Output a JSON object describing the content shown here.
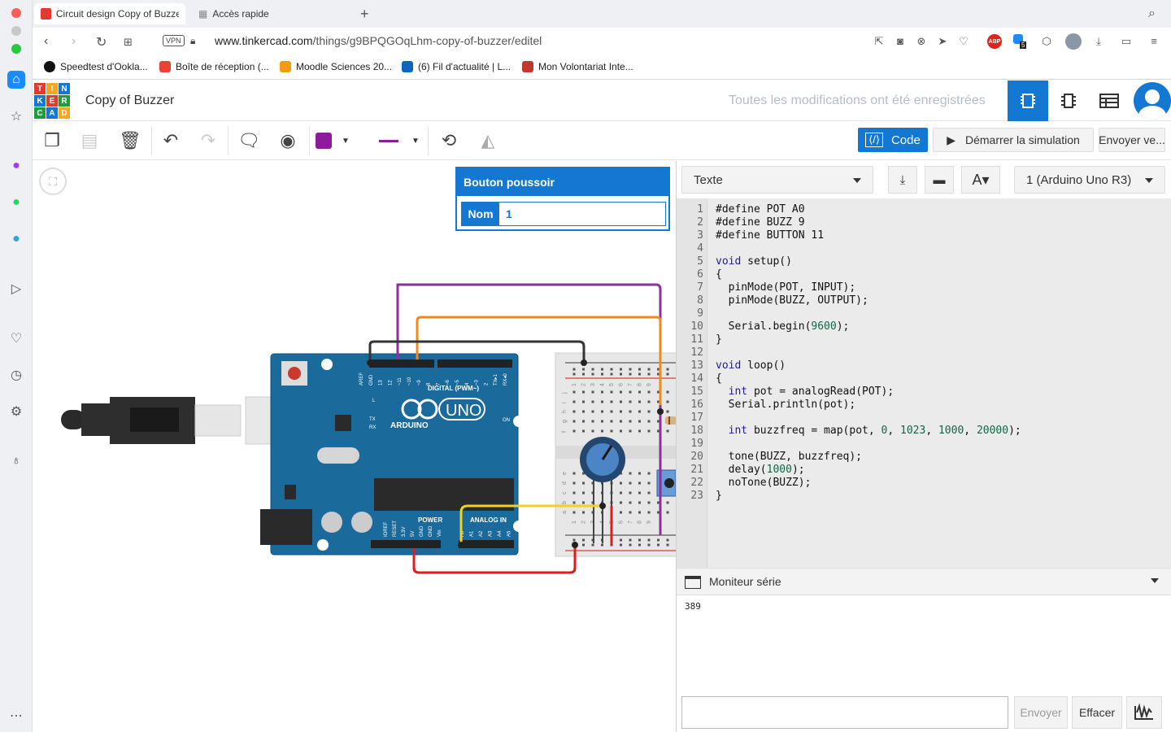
{
  "browser": {
    "tabs": [
      {
        "title": "Circuit design Copy of Buzzer |",
        "active": true
      },
      {
        "title": "Accès rapide",
        "active": false
      }
    ],
    "url_domain": "www.tinkercad.com",
    "url_path": "/things/g9BPQGOqLhm-copy-of-buzzer/editel",
    "vpn_label": "VPN",
    "abp_label": "ABP",
    "ext_badge": "5",
    "bookmarks": [
      {
        "label": "Speedtest d'Ookla...",
        "color": "#111111"
      },
      {
        "label": "Boîte de réception (...",
        "color": "#ea4335"
      },
      {
        "label": "Moodle Sciences 20...",
        "color": "#f39c12"
      },
      {
        "label": "(6) Fil d'actualité | L...",
        "color": "#0a66c2"
      },
      {
        "label": "Mon Volontariat Inte...",
        "color": "#c0392b"
      }
    ]
  },
  "app": {
    "logo_letters": [
      "T",
      "I",
      "N",
      "K",
      "E",
      "R",
      "C",
      "A",
      "D"
    ],
    "logo_colors": [
      "#e23a2e",
      "#f5a623",
      "#1477d2",
      "#1477d2",
      "#e23a2e",
      "#1a9f3c",
      "#1a9f3c",
      "#1477d2",
      "#f5a623"
    ],
    "design_title": "Copy of Buzzer",
    "save_status": "Toutes les modifications ont été enregistrées",
    "accent": "#1477d2"
  },
  "toolbar": {
    "code_label": "Code",
    "simulate_label": "Démarrer la simulation",
    "send_label": "Envoyer ve...",
    "fill_color": "#8e1b9e",
    "line_color": "#8e1b9e"
  },
  "inspector": {
    "title": "Bouton poussoir",
    "name_label": "Nom",
    "name_value": "1"
  },
  "code_panel": {
    "mode": "Texte",
    "device": "1 (Arduino Uno R3)",
    "lines": [
      "#define POT A0",
      "#define BUZZ 9",
      "#define BUTTON 11",
      "",
      "void setup()",
      "{",
      "  pinMode(POT, INPUT);",
      "  pinMode(BUZZ, OUTPUT);",
      "",
      "  Serial.begin(9600);",
      "}",
      "",
      "void loop()",
      "{",
      "  int pot = analogRead(POT);",
      "  Serial.println(pot);",
      "",
      "  int buzzfreq = map(pot, 0, 1023, 1000, 20000);",
      "",
      "  tone(BUZZ, buzzfreq);",
      "  delay(1000);",
      "  noTone(BUZZ);",
      "}"
    ],
    "serial_title": "Moniteur série",
    "serial_output": "389",
    "send_button": "Envoyer",
    "clear_button": "Effacer"
  },
  "board": {
    "brand": "ARDUINO",
    "model": "UNO",
    "digital_label": "DIGITAL (PWM~)",
    "power_label": "POWER",
    "analog_label": "ANALOG IN",
    "on_label": "ON",
    "l_label": "L",
    "tx_label": "TX",
    "rx_label": "RX",
    "top_pins": [
      "AREF",
      "GND",
      "13",
      "12",
      "~11",
      "~10",
      "~9",
      "8",
      "7",
      "~6",
      "~5",
      "4",
      "~3",
      "2",
      "TX▸1",
      "RX◂0"
    ],
    "power_pins": [
      "IOREF",
      "RESET",
      "3.3V",
      "5V",
      "GND",
      "GND",
      "Vin"
    ],
    "analog_pins": [
      "A0",
      "A1",
      "A2",
      "A3",
      "A4",
      "A5"
    ]
  },
  "breadboard": {
    "row_letters_top": [
      "j",
      "i",
      "h",
      "g",
      "f"
    ],
    "row_letters_bottom": [
      "e",
      "d",
      "c",
      "b",
      "a"
    ],
    "col_numbers": [
      "1",
      "2",
      "3",
      "4",
      "5",
      "6",
      "7",
      "8",
      "9"
    ]
  },
  "wires": {
    "purple": "#8e2f9e",
    "orange": "#f08a1c",
    "black": "#333333",
    "red": "#e01b1b",
    "yellow": "#f2d21b"
  }
}
